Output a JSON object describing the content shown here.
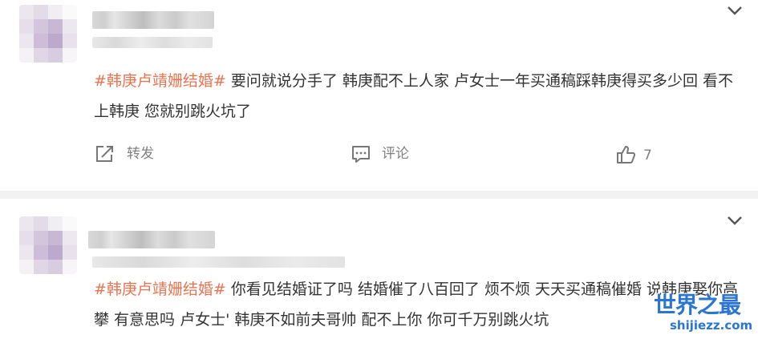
{
  "posts": [
    {
      "hashtag": "#韩庚卢靖姗结婚#",
      "body": " 要问就说分手了 韩庚配不上人家 卢女士一年买通稿踩韩庚得买多少回 看不上韩庚 您就别跳火坑了",
      "actions": {
        "repost_label": "转发",
        "comment_label": "评论",
        "like_count": "7"
      }
    },
    {
      "hashtag": "#韩庚卢靖姗结婚#",
      "body": " 你看见结婚证了吗 结婚催了八百回了 烦不烦 天天买通稿催婚 说韩庚娶你高攀 有意思吗 卢女士' 韩庚不如前夫哥帅 配不上你 你可千万别跳火坑"
    }
  ],
  "watermark": {
    "title": "世界之最",
    "url": "shijiezz.com"
  },
  "colors": {
    "tag": "#eb7350",
    "text": "#333333",
    "action": "#808080",
    "watermark": "#2a76d2"
  },
  "icons": [
    "chevron-down-icon",
    "repost-icon",
    "comment-icon",
    "like-icon"
  ]
}
